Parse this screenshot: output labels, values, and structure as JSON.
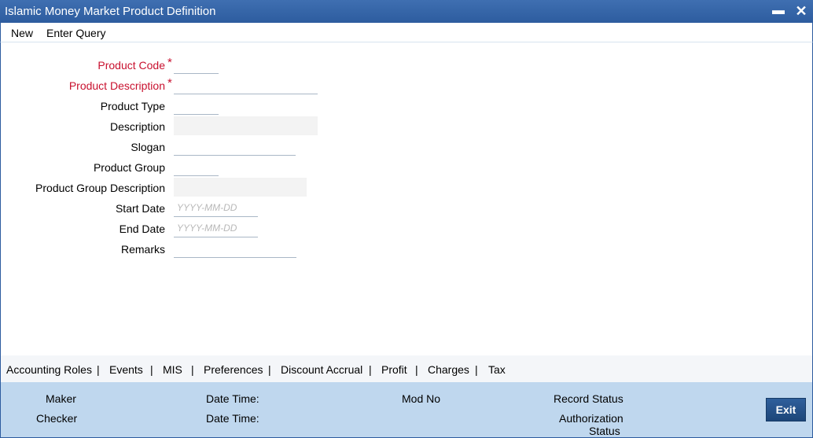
{
  "window": {
    "title": "Islamic Money Market Product Definition",
    "minimize_icon": "minimize-icon",
    "close_icon": "close-icon"
  },
  "menu": {
    "new": "New",
    "enter_query": "Enter Query"
  },
  "form": {
    "product_code": {
      "label": "Product Code",
      "required": "*",
      "value": ""
    },
    "product_description": {
      "label": "Product Description",
      "required": "*",
      "value": ""
    },
    "product_type": {
      "label": "Product Type",
      "value": ""
    },
    "description": {
      "label": "Description",
      "value": ""
    },
    "slogan": {
      "label": "Slogan",
      "value": ""
    },
    "product_group": {
      "label": "Product Group",
      "value": ""
    },
    "product_group_description": {
      "label": "Product Group Description",
      "value": ""
    },
    "start_date": {
      "label": "Start Date",
      "placeholder": "YYYY-MM-DD",
      "value": ""
    },
    "end_date": {
      "label": "End Date",
      "placeholder": "YYYY-MM-DD",
      "value": ""
    },
    "remarks": {
      "label": "Remarks",
      "value": ""
    }
  },
  "tabs": [
    "Accounting Roles",
    "Events",
    "MIS",
    "Preferences",
    "Discount Accrual",
    "Profit",
    "Charges",
    "Tax"
  ],
  "tab_separator": "|",
  "footer": {
    "maker": "Maker",
    "checker": "Checker",
    "date_time_1": "Date Time:",
    "date_time_2": "Date Time:",
    "mod_no": "Mod No",
    "record_status": "Record Status",
    "authorization_status_1": "Authorization",
    "authorization_status_2": "Status",
    "exit": "Exit"
  },
  "colors": {
    "titlebar": "#2d5c9f",
    "required": "#c8102e",
    "footer": "#bfd7ee",
    "exit_button": "#1d4679"
  }
}
